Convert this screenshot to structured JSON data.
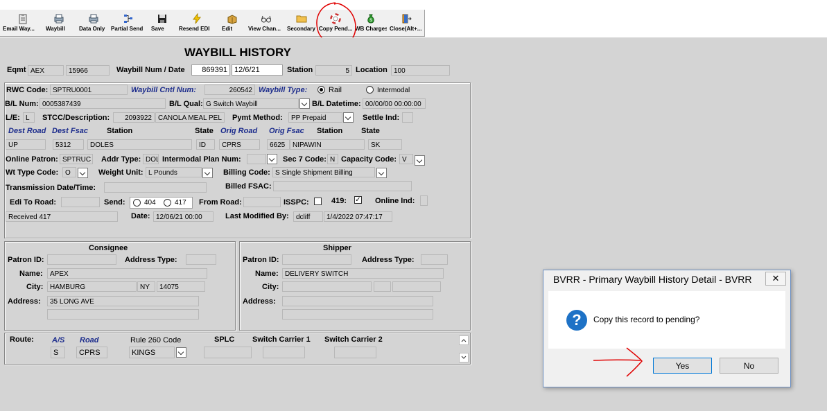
{
  "toolbar": {
    "buttons": [
      {
        "label": "Email Way...",
        "icon": "clipboard-icon"
      },
      {
        "label": "Waybill",
        "icon": "printer-icon"
      },
      {
        "label": "Data Only",
        "icon": "printer-icon"
      },
      {
        "label": "Partial Send",
        "icon": "network-icon"
      },
      {
        "label": "Save",
        "icon": "floppy-icon"
      },
      {
        "label": "Resend EDI",
        "icon": "lightning-icon"
      },
      {
        "label": "Edit",
        "icon": "box-edit-icon"
      },
      {
        "label": "View Chan...",
        "icon": "glasses-icon"
      },
      {
        "label": "Secondary",
        "icon": "folder-icon"
      },
      {
        "label": "Copy Pend...",
        "icon": "lifebuoy-icon"
      },
      {
        "label": "WB Charges",
        "icon": "money-bag-icon"
      },
      {
        "label": "Close(Alt+...",
        "icon": "exit-door-icon"
      }
    ]
  },
  "form": {
    "title": "WAYBILL HISTORY",
    "eqmt_label": "Eqmt",
    "eqmt_initial": "AEX",
    "eqmt_number": "15966",
    "waybill_label": "Waybill Num / Date",
    "waybill_num": "869391",
    "waybill_date": "12/6/21",
    "station_label": "Station",
    "station_value": "5",
    "location_label": "Location",
    "location_value": "100",
    "rwc_code_label": "RWC Code:",
    "rwc_code": "SPTRU0001",
    "waybill_cntl_label": "Waybill Cntl Num:",
    "waybill_cntl": "260542",
    "waybill_type_label": "Waybill Type:",
    "rail_label": "Rail",
    "intermodal_label": "Intermodal",
    "bl_num_label": "B/L Num:",
    "bl_num": "0005387439",
    "bl_qual_label": "B/L Qual:",
    "bl_qual": "G Switch Waybill",
    "bl_datetime_label": "B/L Datetime:",
    "bl_datetime": "00/00/00 00:00:00",
    "le_label": "L/E:",
    "le_value": "L",
    "stcc_label": "STCC/Description:",
    "stcc_code": "2093922",
    "stcc_desc": "CANOLA MEAL PEL",
    "pymt_label": "Pymt Method:",
    "pymt_value": "PP Prepaid",
    "settle_label": "Settle Ind:",
    "dest_road_label": "Dest Road",
    "dest_fsac_label": "Dest Fsac",
    "station_col_label": "Station",
    "state_col_label": "State",
    "orig_road_label": "Orig Road",
    "orig_fsac_label": "Orig Fsac",
    "dest_road": "UP",
    "dest_fsac": "5312",
    "dest_station": "DOLES",
    "dest_state": "ID",
    "orig_road": "CPRS",
    "orig_fsac": "6625",
    "orig_station": "NIPAWIN",
    "orig_state": "SK",
    "online_patron_label": "Online Patron:",
    "online_patron": "SPTRUC",
    "addr_type_label": "Addr Type:",
    "addr_type": "DOL",
    "intermodal_plan_label": "Intermodal Plan Num:",
    "sec7_label": "Sec 7 Code:",
    "sec7_value": "N",
    "capacity_label": "Capacity Code:",
    "capacity_value": "V",
    "wt_type_label": "Wt Type Code:",
    "wt_type": "O",
    "weight_unit_label": "Weight Unit:",
    "weight_unit": "L Pounds",
    "billing_code_label": "Billing Code:",
    "billing_code": "S Single Shipment Billing",
    "trans_dt_label": "Transmission Date/Time:",
    "billed_fsac_label": "Billed FSAC:",
    "edi_to_road_label": "Edi To Road:",
    "send_label": "Send:",
    "send_404": "404",
    "send_417": "417",
    "from_road_label": "From Road:",
    "isspc_label": "ISSPC:",
    "f419_label": "419:",
    "online_ind_label": "Online Ind:",
    "received_status": "Received 417",
    "date_label": "Date:",
    "date_value": "12/06/21 00:00",
    "last_mod_label": "Last Modified By:",
    "last_mod_user": "dcliff",
    "last_mod_time": "1/4/2022 07:47:17"
  },
  "consignee": {
    "header": "Consignee",
    "patron_id_label": "Patron ID:",
    "address_type_label": "Address Type:",
    "name_label": "Name:",
    "name": "APEX",
    "city_label": "City:",
    "city": "HAMBURG",
    "state": "NY",
    "zip": "14075",
    "address_label": "Address:",
    "address1": "35 LONG AVE"
  },
  "shipper": {
    "header": "Shipper",
    "patron_id_label": "Patron ID:",
    "address_type_label": "Address Type:",
    "name_label": "Name:",
    "name": "DELIVERY SWITCH",
    "city_label": "City:",
    "address_label": "Address:"
  },
  "route": {
    "route_label": "Route:",
    "as_label": "A/S",
    "road_label": "Road",
    "rule260_label": "Rule 260 Code",
    "splc_label": "SPLC",
    "sc1_label": "Switch Carrier 1",
    "sc2_label": "Switch Carrier 2",
    "as_value": "S",
    "road_value": "CPRS",
    "rule260_value": "KINGS"
  },
  "dialog": {
    "title": "BVRR - Primary Waybill History Detail - BVRR",
    "close_glyph": "✕",
    "message": "Copy this record to pending?",
    "yes_label": "Yes",
    "no_label": "No"
  }
}
